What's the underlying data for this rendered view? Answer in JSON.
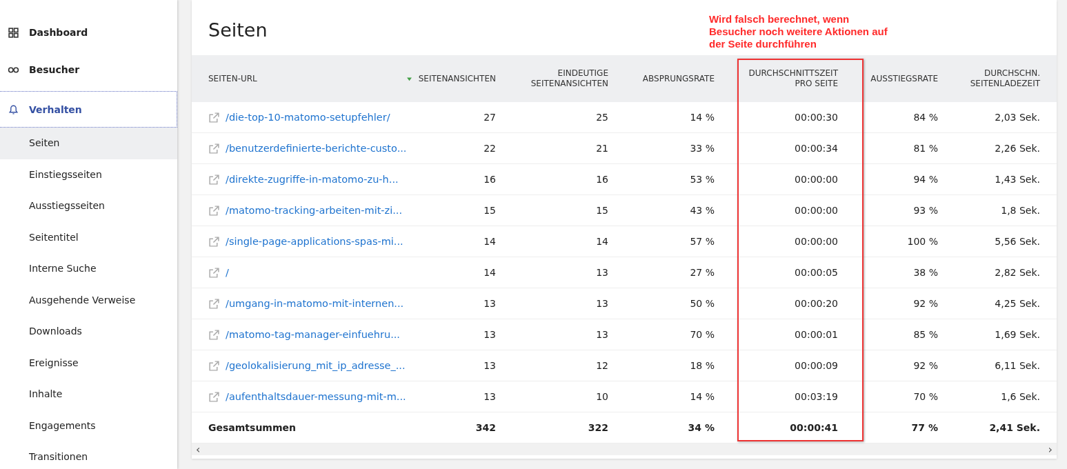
{
  "sidebar": {
    "items": [
      {
        "label": "Dashboard",
        "selected": false,
        "expanded": false
      },
      {
        "label": "Besucher",
        "selected": false,
        "expanded": false
      },
      {
        "label": "Verhalten",
        "selected": true,
        "expanded": true,
        "children": [
          {
            "label": "Seiten",
            "selected": true
          },
          {
            "label": "Einstiegsseiten",
            "selected": false
          },
          {
            "label": "Ausstiegsseiten",
            "selected": false
          },
          {
            "label": "Seitentitel",
            "selected": false
          },
          {
            "label": "Interne Suche",
            "selected": false
          },
          {
            "label": "Ausgehende Verweise",
            "selected": false
          },
          {
            "label": "Downloads",
            "selected": false
          },
          {
            "label": "Ereignisse",
            "selected": false
          },
          {
            "label": "Inhalte",
            "selected": false
          },
          {
            "label": "Engagements",
            "selected": false
          },
          {
            "label": "Transitionen",
            "selected": false
          }
        ]
      }
    ]
  },
  "report": {
    "title": "Seiten",
    "annotation": {
      "text": "Wird falsch berechnet, wenn Besucher noch weitere Aktionen auf der Seite durchführen"
    },
    "table": {
      "columns": [
        {
          "label": "SEITEN-URL",
          "sorted": false,
          "highlighted": false
        },
        {
          "label": "SEITENANSICHTEN",
          "sorted": true,
          "highlighted": false
        },
        {
          "label": "EINDEUTIGE SEITENANSICHTEN",
          "sorted": false,
          "highlighted": false
        },
        {
          "label": "ABSPRUNGSRATE",
          "sorted": false,
          "highlighted": false
        },
        {
          "label": "DURCHSCHNITTSZEIT PRO SEITE",
          "sorted": false,
          "highlighted": true
        },
        {
          "label": "AUSSTIEGSRATE",
          "sorted": false,
          "highlighted": false
        },
        {
          "label": "DURCHSCHN. SEITENLADEZEIT",
          "sorted": false,
          "highlighted": false
        }
      ],
      "rows": [
        {
          "cells": [
            "/die-top-10-matomo-setupfehler/",
            "27",
            "25",
            "14 %",
            "00:00:30",
            "84 %",
            "2,03 Sek."
          ]
        },
        {
          "cells": [
            "/benutzerdefinierte-berichte-custo...",
            "22",
            "21",
            "33 %",
            "00:00:34",
            "81 %",
            "2,26 Sek."
          ]
        },
        {
          "cells": [
            "/direkte-zugriffe-in-matomo-zu-h...",
            "16",
            "16",
            "53 %",
            "00:00:00",
            "94 %",
            "1,43 Sek."
          ]
        },
        {
          "cells": [
            "/matomo-tracking-arbeiten-mit-zi...",
            "15",
            "15",
            "43 %",
            "00:00:00",
            "93 %",
            "1,8 Sek."
          ]
        },
        {
          "cells": [
            "/single-page-applications-spas-mi...",
            "14",
            "14",
            "57 %",
            "00:00:00",
            "100 %",
            "5,56 Sek."
          ]
        },
        {
          "cells": [
            "/",
            "14",
            "13",
            "27 %",
            "00:00:05",
            "38 %",
            "2,82 Sek."
          ]
        },
        {
          "cells": [
            "/umgang-in-matomo-mit-internen...",
            "13",
            "13",
            "50 %",
            "00:00:20",
            "92 %",
            "4,25 Sek."
          ]
        },
        {
          "cells": [
            "/matomo-tag-manager-einfuehru...",
            "13",
            "13",
            "70 %",
            "00:00:01",
            "85 %",
            "1,69 Sek."
          ]
        },
        {
          "cells": [
            "/geolokalisierung_mit_ip_adresse_...",
            "13",
            "12",
            "18 %",
            "00:00:09",
            "92 %",
            "6,11 Sek."
          ]
        },
        {
          "cells": [
            "/aufenthaltsdauer-messung-mit-m...",
            "13",
            "10",
            "14 %",
            "00:03:19",
            "70 %",
            "1,6 Sek."
          ]
        }
      ],
      "totals": {
        "cells": [
          "Gesamtsummen",
          "342",
          "322",
          "34 %",
          "00:00:41",
          "77 %",
          "2,41 Sek."
        ]
      }
    },
    "scrollbar": {
      "left": "‹",
      "right": "›"
    }
  }
}
